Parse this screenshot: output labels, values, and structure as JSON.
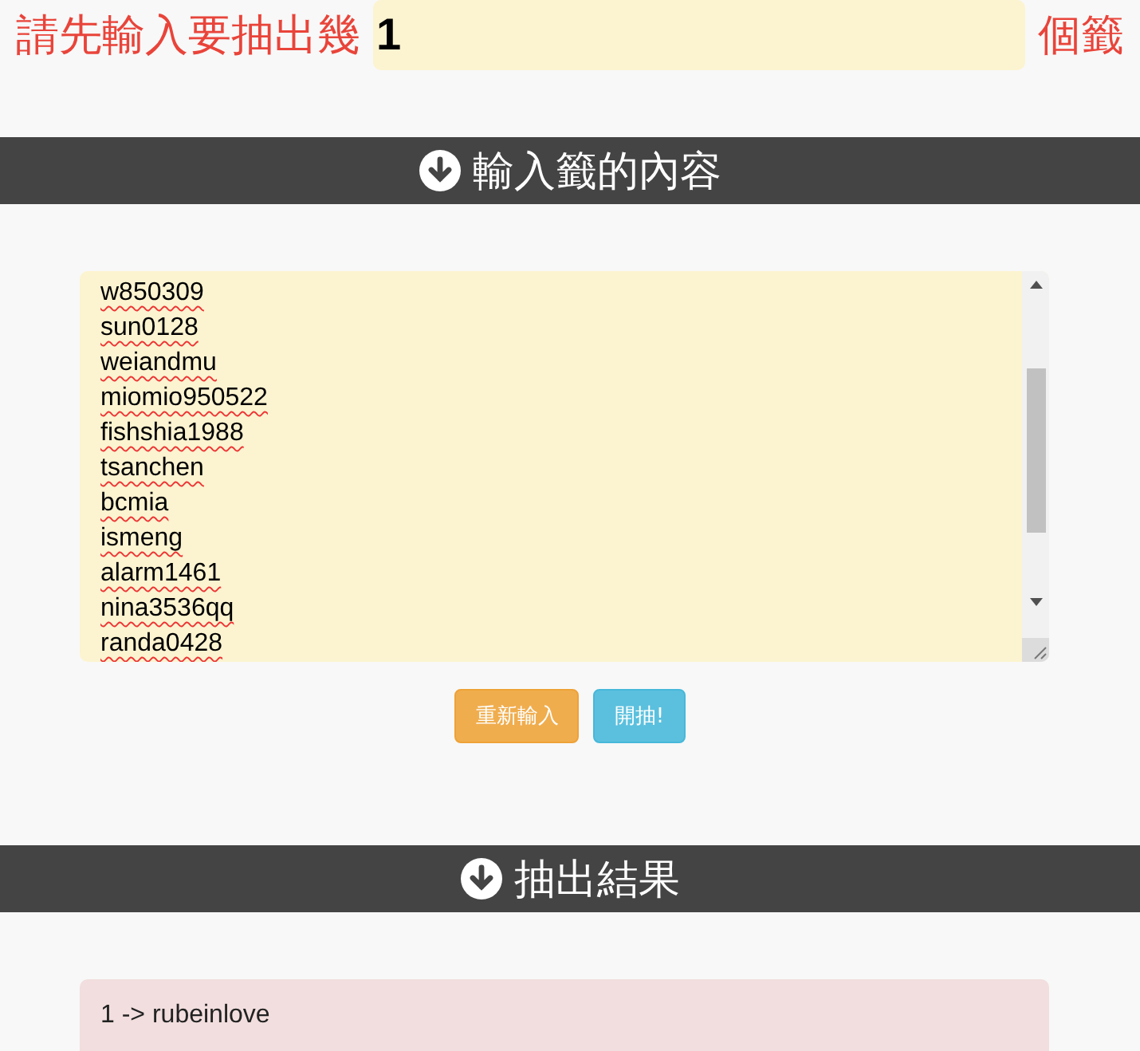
{
  "draw_count": {
    "prefix": "請先輸入要抽出幾",
    "value": "1",
    "suffix": "個籤"
  },
  "input_section": {
    "title": "輸入籤的內容",
    "entries": [
      "w850309",
      "sun0128",
      "weiandmu",
      "miomio950522",
      "fishshia1988",
      "tsanchen",
      "bcmia",
      "ismeng",
      "alarm1461",
      "nina3536qq",
      "randa0428"
    ],
    "buttons": [
      {
        "label": "重新輸入",
        "kind": "reset"
      },
      {
        "label": "開抽!",
        "kind": "start"
      }
    ]
  },
  "result_section": {
    "title": "抽出結果",
    "results": [
      "1 -> rubeinlove"
    ]
  }
}
